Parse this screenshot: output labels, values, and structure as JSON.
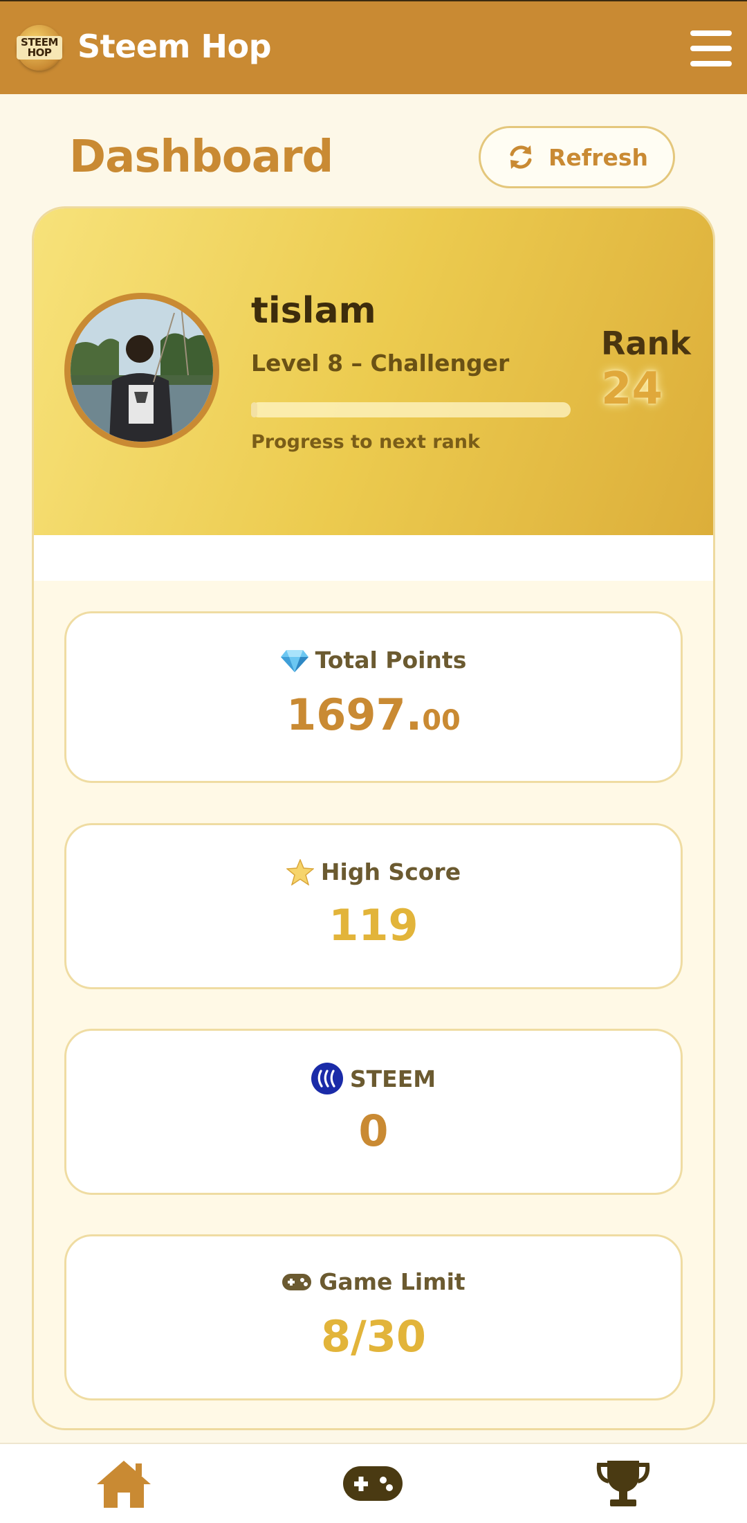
{
  "header": {
    "logo_text": "STEEM HOP",
    "title": "Steem Hop"
  },
  "page": {
    "title": "Dashboard",
    "refresh_label": "Refresh"
  },
  "profile": {
    "username": "tislam",
    "level": "Level 8 – Challenger",
    "progress_label": "Progress to next rank",
    "progress_fraction": 0.02,
    "rank_label": "Rank",
    "rank_value": "24"
  },
  "stats": [
    {
      "icon": "diamond-icon",
      "label": "Total Points",
      "value_main": "1697.",
      "value_decimal": "00",
      "color": "#c98a33"
    },
    {
      "icon": "star-icon",
      "label": "High Score",
      "value_main": "119",
      "color": "#e2b43a"
    },
    {
      "icon": "steem-icon",
      "label": "STEEM",
      "value_main": "0",
      "color": "#c98a33"
    },
    {
      "icon": "gamepad-icon",
      "label": "Game Limit",
      "value_main": "8/30",
      "color": "#e2b43a"
    }
  ],
  "nav": [
    {
      "icon": "home-icon",
      "name": "Home"
    },
    {
      "icon": "gamepad-icon",
      "name": "Game"
    },
    {
      "icon": "trophy-icon",
      "name": "Leaderboard"
    }
  ],
  "colors": {
    "header": "#c98a33",
    "accent": "#c98a33",
    "gold": "#e2b43a",
    "background": "#fdf8e8"
  }
}
